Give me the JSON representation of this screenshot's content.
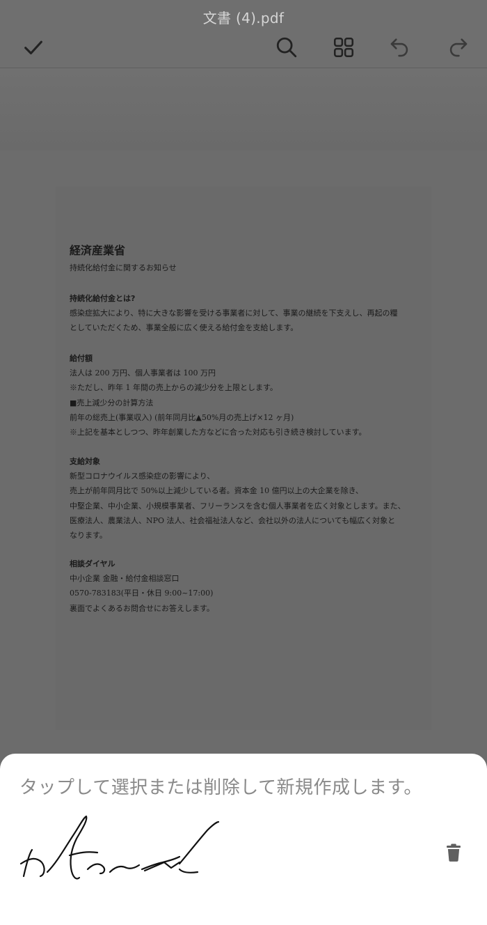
{
  "header": {
    "title": "文書 (4).pdf",
    "icons": {
      "done": "check-icon",
      "search": "search-icon",
      "grid": "grid-icon",
      "undo": "undo-icon",
      "redo": "redo-icon"
    }
  },
  "document": {
    "title": "経済産業省",
    "subtitle": "持続化給付金に関するお知らせ",
    "sections": [
      {
        "heading": "持続化給付金とは?",
        "lines": [
          "感染症拡大により、特に大きな影響を受ける事業者に対して、事業の継続を下支えし、再起の糧",
          "としていただくため、事業全般に広く使える給付金を支給します。"
        ]
      },
      {
        "heading": "給付額",
        "lines": [
          "法人は 200 万円、個人事業者は 100 万円",
          "※ただし、昨年 1 年間の売上からの減少分を上限とします。",
          "■売上減少分の計算方法",
          "前年の総売上(事業収入) (前年同月比▲50%月の売上げ×12 ヶ月)",
          "※上記を基本としつつ、昨年創業した方などに合った対応も引き続き検討しています。"
        ]
      },
      {
        "heading": "支給対象",
        "lines": [
          "新型コロナウイルス感染症の影響により、",
          "売上が前年同月比で 50%以上減少している者。資本金 10 億円以上の大企業を除き、",
          "中堅企業、中小企業、小規模事業者、フリーランスを含む個人事業者を広く対象とします。また、",
          "医療法人、農業法人、NPO 法人、社会福祉法人など、会社以外の法人についても幅広く対象と",
          "なります。"
        ]
      },
      {
        "heading": "相談ダイヤル",
        "lines": [
          "中小企業 金融・給付金相談窓口",
          "0570-783183(平日・休日 9:00~17:00)",
          "裏面でよくあるお問合せにお答えします。"
        ]
      }
    ]
  },
  "signature_sheet": {
    "hint": "タップして選択または削除して新規作成します。",
    "signature_icon": "signature-image",
    "delete_icon": "trash-icon"
  },
  "colors": {
    "overlay": "#6c6c6c",
    "toolbar_icon": "#1f1f1f",
    "sheet_bg": "#ffffff",
    "hint_text": "#8a8a8a",
    "trash": "#5f5f5f"
  }
}
